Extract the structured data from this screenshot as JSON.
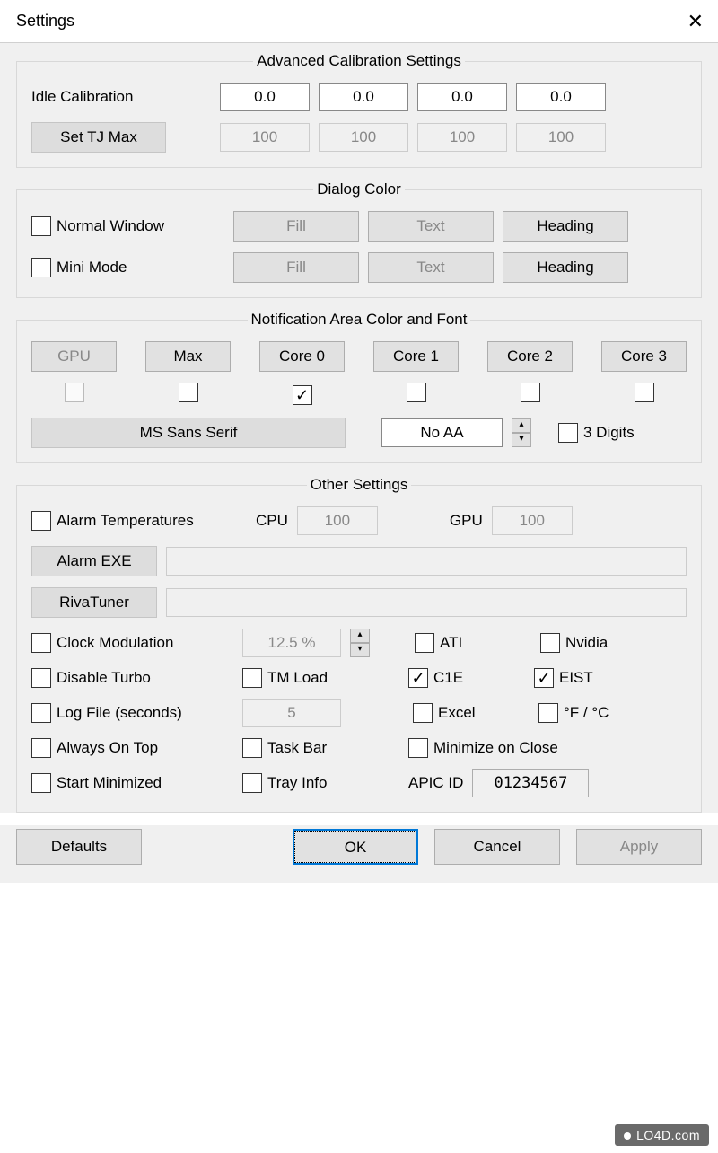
{
  "window": {
    "title": "Settings"
  },
  "calibration": {
    "legend": "Advanced Calibration Settings",
    "idle_label": "Idle Calibration",
    "idle_values": [
      "0.0",
      "0.0",
      "0.0",
      "0.0"
    ],
    "tjmax_button": "Set TJ Max",
    "tjmax_values": [
      "100",
      "100",
      "100",
      "100"
    ]
  },
  "dialog_color": {
    "legend": "Dialog Color",
    "normal_label": "Normal Window",
    "mini_label": "Mini Mode",
    "fill": "Fill",
    "text": "Text",
    "heading": "Heading"
  },
  "notification": {
    "legend": "Notification Area Color and Font",
    "buttons": [
      "GPU",
      "Max",
      "Core 0",
      "Core 1",
      "Core 2",
      "Core 3"
    ],
    "checks": [
      false,
      false,
      true,
      false,
      false,
      false
    ],
    "font_button": "MS Sans Serif",
    "aa_value": "No AA",
    "digits_label": "3 Digits"
  },
  "other": {
    "legend": "Other Settings",
    "alarm_temp_label": "Alarm Temperatures",
    "cpu_label": "CPU",
    "cpu_value": "100",
    "gpu_label": "GPU",
    "gpu_value": "100",
    "alarm_exe": "Alarm EXE",
    "rivatuner": "RivaTuner",
    "clock_mod_label": "Clock Modulation",
    "clock_mod_value": "12.5 %",
    "ati_label": "ATI",
    "nvidia_label": "Nvidia",
    "disable_turbo": "Disable Turbo",
    "tm_load": "TM Load",
    "c1e": "C1E",
    "eist": "EIST",
    "log_file": "Log File (seconds)",
    "log_value": "5",
    "excel": "Excel",
    "fc": "°F / °C",
    "always_top": "Always On Top",
    "task_bar": "Task Bar",
    "min_close": "Minimize on Close",
    "start_min": "Start Minimized",
    "tray_info": "Tray Info",
    "apic_label": "APIC ID",
    "apic_value": "01234567"
  },
  "footer": {
    "defaults": "Defaults",
    "ok": "OK",
    "cancel": "Cancel",
    "apply": "Apply"
  },
  "watermark": "LO4D.com"
}
